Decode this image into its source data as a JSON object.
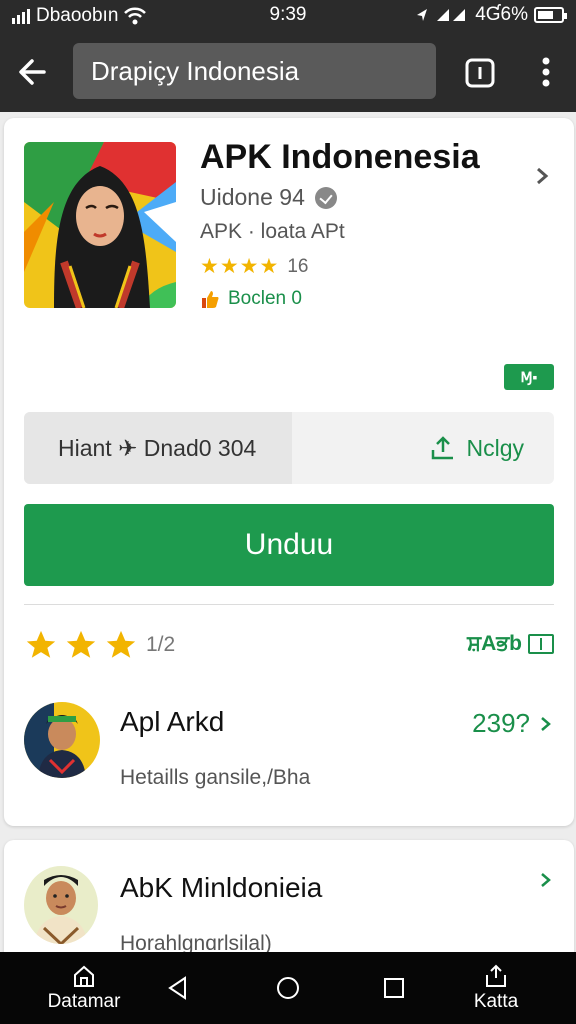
{
  "status_bar": {
    "carrier": "Dbaoobın",
    "time": "9:39",
    "battery_text": "4Ɠ6%",
    "battery_level": 0.66
  },
  "app_bar": {
    "url_text": "Drapiçy Indonesia"
  },
  "app": {
    "title": "APK Indonenesia",
    "developer": "Uidone 94",
    "category": "APK · loata APt",
    "stars": "★★★★",
    "rating_count": "16",
    "badge_text": "Boclen 0",
    "tag_text": "Ɱ▪",
    "split_left": "Hiant ✈ Dnad0 304",
    "split_right": "Nclgy",
    "install_label": "Unduu",
    "rating_value": 3.5,
    "rating_text": "1/2",
    "rating_right": "ਸ਼Aਭb"
  },
  "people": [
    {
      "name": "Apl Arkd",
      "subtitle": "Hetaills gansile,/Bha",
      "count": "239?"
    },
    {
      "name": "AbK Minldonieia",
      "subtitle": "Horahlgnɑrlsilal)",
      "count": ""
    }
  ],
  "navbar": {
    "left_label": "Datamar",
    "right_label": "Katta"
  },
  "colors": {
    "accent_green": "#1e9a4e",
    "star_yellow": "#f2b400",
    "appbar_dark": "#2b2b2b"
  }
}
